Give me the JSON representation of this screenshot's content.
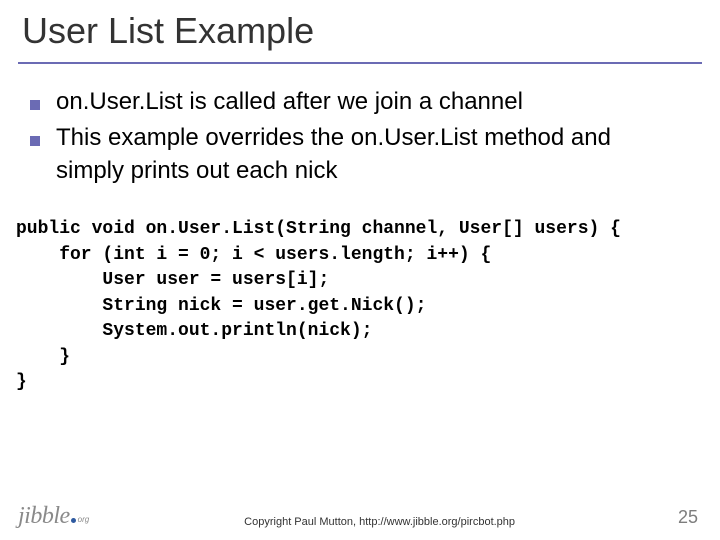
{
  "title": "User List Example",
  "bullets": [
    "on.User.List is called after we join a channel",
    "This example overrides the on.User.List method and simply prints out each nick"
  ],
  "code": {
    "l1": "public void on.User.List(String channel, User[] users) {",
    "l2": "    for (int i = 0; i < users.length; i++) {",
    "l3": "        User user = users[i];",
    "l4": "        String nick = user.get.Nick();",
    "l5": "        System.out.println(nick);",
    "l6": "    }",
    "l7": "}"
  },
  "footer": {
    "logo_main": "jibble",
    "logo_tld": "org",
    "copyright": "Copyright Paul Mutton, http://www.jibble.org/pircbot.php",
    "page": "25"
  }
}
